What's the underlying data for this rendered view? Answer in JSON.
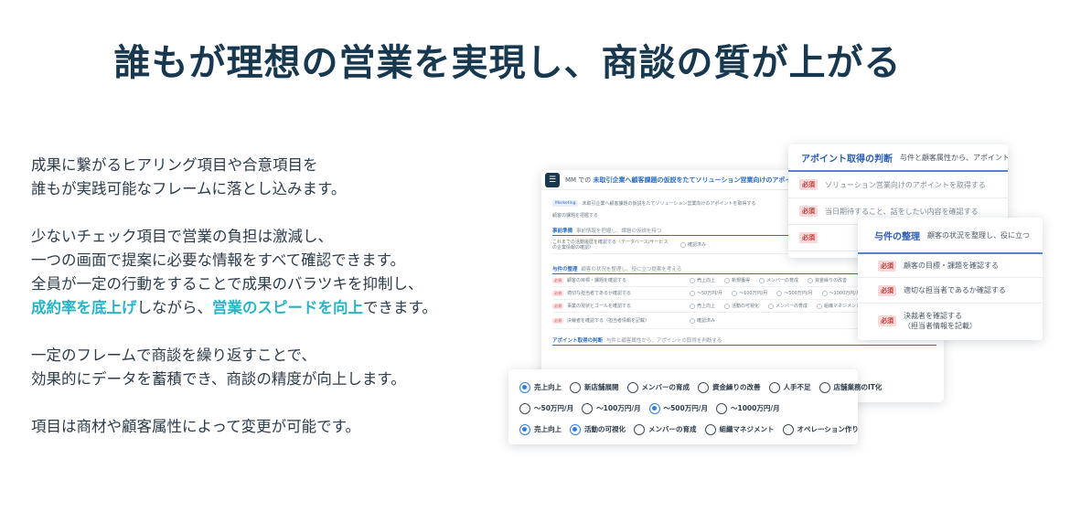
{
  "headline": "誰もが理想の営業を実現し、商談の質が上がる",
  "body": {
    "p1_line1": "成果に繋がるヒアリング項目や合意項目を",
    "p1_line2": "誰もが実践可能なフレームに落とし込みます。",
    "p2_line1": "少ないチェック項目で営業の負担は激減し、",
    "p2_line2": "一つの画面で提案に必要な情報をすべて確認できます。",
    "p2_line3": "全員が一定の行動をすることで成果のバラツキを抑制し、",
    "p2_line4_hl1": "成約率を底上げ",
    "p2_line4_mid": "しながら、",
    "p2_line4_hl2": "営業のスピードを向上",
    "p2_line4_end": "できます。",
    "p3_line1": "一定のフレームで商談を繰り返すことで、",
    "p3_line2": "効果的にデータを蓄積でき、商談の精度が向上します。",
    "p4_line1": "項目は商材や顧客属性によって変更が可能です。"
  },
  "mock": {
    "main_title_prefix": "MM での",
    "main_title_highlight": "未取引企業へ顧客課題の仮説をたてソリューション営業向けのアポイントを",
    "tag": "Marketing",
    "tag_text": "未取引企業へ顧客課題の仮説をたてソリューション営業向けのアポイントを取得する",
    "prep_label": "顧客の課題を把握する",
    "section1": "事前準備",
    "section1_sub": "事前情報を把握し、課題の仮説を持つ",
    "row1_text": "これまでの活動履歴を確認する（データベース/サービスの企業情報の確認）",
    "row1_opt": "確認済み",
    "section2": "与件の整理",
    "section2_sub": "顧客の状況を整理し、役に立つ提案を考える",
    "rows2": [
      {
        "badge": "必須",
        "text": "顧客の目標・課題を確認する",
        "opts": [
          "売上向上",
          "新規獲得",
          "メンバーの育成",
          "資金繰りの改善"
        ]
      },
      {
        "badge": "必須",
        "text": "適切な担当者であるか確認する",
        "opts": [
          "〜50万円/月",
          "〜100万円/月",
          "〜500万円/月",
          "〜1000万円/月"
        ]
      },
      {
        "badge": "必須",
        "text": "事業の現状とゴールを確認する",
        "opts": [
          "売上向上",
          "活動の可視化",
          "メンバーの育成",
          "組織マネジメント"
        ]
      },
      {
        "badge": "必須",
        "text": "決裁者を確認する（担当者情報を記載）",
        "opts": [
          "確認済み"
        ]
      }
    ],
    "section3": "アポイント取得の判断",
    "section3_sub": "与件と顧客属性から、アポイントの取得を判断する"
  },
  "card_a": {
    "title": "アポイント取得の判断",
    "subtitle": "与件と顧客属性から、アポイントの取",
    "rows": [
      {
        "badge": "必須",
        "text": "ソリューション営業向けのアポイントを取得する"
      },
      {
        "badge": "必須",
        "text": "当日期待すること、話をしたい内容を確認する"
      },
      {
        "badge": "必須",
        "text": ""
      }
    ]
  },
  "card_b": {
    "title": "与件の整理",
    "subtitle": "顧客の状況を整理し、役に立つ",
    "rows": [
      {
        "badge": "必須",
        "text1": "顧客の目標・課題を確認する",
        "text2": ""
      },
      {
        "badge": "必須",
        "text1": "適切な担当者であるか確認する",
        "text2": ""
      },
      {
        "badge": "必須",
        "text1": "決裁者を確認する",
        "text2": "（担当者情報を記載）"
      }
    ]
  },
  "options": {
    "row1": [
      {
        "label": "売上向上",
        "selected": true
      },
      {
        "label": "新店舗展開",
        "selected": false
      },
      {
        "label": "メンバーの育成",
        "selected": false
      },
      {
        "label": "資金繰りの改善",
        "selected": false
      },
      {
        "label": "人手不足",
        "selected": false
      },
      {
        "label": "店舗業務のIT化",
        "selected": false
      }
    ],
    "row2": [
      {
        "label": "〜50万円/月",
        "selected": false
      },
      {
        "label": "〜100万円/月",
        "selected": false
      },
      {
        "label": "〜500万円/月",
        "selected": true
      },
      {
        "label": "〜1000万円/月",
        "selected": false
      }
    ],
    "row3": [
      {
        "label": "売上向上",
        "selected": true
      },
      {
        "label": "活動の可視化",
        "selected": true
      },
      {
        "label": "メンバーの育成",
        "selected": false
      },
      {
        "label": "組織マネジメント",
        "selected": false
      },
      {
        "label": "オペレーション作り",
        "selected": false
      }
    ]
  },
  "colors": {
    "headline": "#17384f",
    "highlight": "#2ab3c4",
    "accent_blue": "#2b5db3",
    "required_red": "#c63a3a"
  },
  "icons": {
    "menu": "menu-icon"
  }
}
